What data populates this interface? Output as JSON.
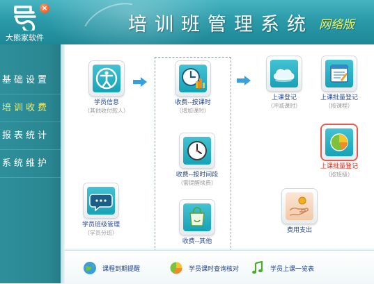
{
  "header": {
    "brand_name": "大熊家软件",
    "logo_close": "×",
    "app_title": "培训班管理系统",
    "edition": "网络版"
  },
  "sidebar": {
    "items": [
      {
        "label": "基础设置",
        "active": false
      },
      {
        "label": "培训收费",
        "active": true
      },
      {
        "label": "报表统计",
        "active": false
      },
      {
        "label": "系统维护",
        "active": false
      }
    ]
  },
  "workflow": {
    "student_info": {
      "label": "学员信息",
      "sub": "（其他收付款人）",
      "icon": "person-icon"
    },
    "fee_by_class_hours": {
      "label": "收费--按课时",
      "sub": "（增加课时）",
      "icon": "clock-chart-icon"
    },
    "fee_by_period": {
      "label": "收费--按时间段",
      "sub": "（需提醒续费）",
      "icon": "wall-clock-icon"
    },
    "fee_other": {
      "label": "收费--其他",
      "sub": "",
      "icon": "shopping-bag-icon"
    },
    "class_checkin": {
      "label": "上课登记",
      "sub": "（冲减课时）",
      "icon": "cloud-icon"
    },
    "batch_checkin_course": {
      "label": "上课批量登记",
      "sub": "（按课程）",
      "icon": "notepad-icon"
    },
    "batch_checkin_class": {
      "label": "上课批量登记",
      "sub": "（按班级）",
      "icon": "pie-chart-icon"
    },
    "student_class_mgmt": {
      "label": "学员班级管理",
      "sub": "（学员分班）",
      "icon": "chat-bubble-icon"
    },
    "expense": {
      "label": "费用支出",
      "sub": "",
      "icon": "hand-coin-icon"
    }
  },
  "bottom_links": [
    {
      "label": "课程到期提醒",
      "icon": "globe-icon"
    },
    {
      "label": "学员课时查询核对",
      "icon": "pie-search-icon"
    },
    {
      "label": "学员上课一览表",
      "icon": "music-note-icon"
    }
  ],
  "colors": {
    "header": "#2b9aa9",
    "sidebar": "#2a8792",
    "active_menu": "#f3f06a",
    "tile": "#17a2b7",
    "link_text": "#2a4a8e",
    "selected_border": "#e55a4c",
    "flow_arrow": "#3aa0dc"
  }
}
